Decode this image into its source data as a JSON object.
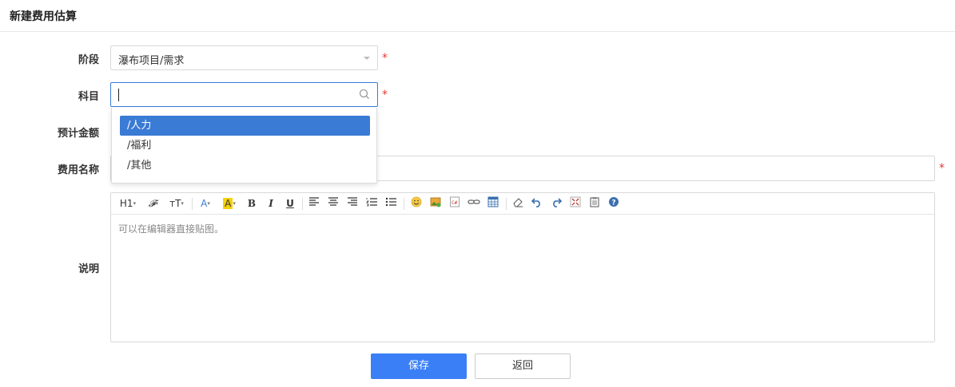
{
  "header": {
    "title": "新建费用估算"
  },
  "form": {
    "stage": {
      "label": "阶段",
      "value": "瀑布项目/需求",
      "required": "*"
    },
    "subject": {
      "label": "科目",
      "value": "",
      "required": "*",
      "options": [
        "/人力",
        "/福利",
        "/其他"
      ],
      "selected_index": 0
    },
    "amount": {
      "label": "预计金额"
    },
    "name": {
      "label": "费用名称",
      "value": "",
      "required": "*"
    },
    "desc": {
      "label": "说明",
      "placeholder": "可以在编辑器直接贴图。"
    }
  },
  "toolbar": {
    "heading": "H1",
    "font": "𝓕",
    "size": "тT",
    "font_color": "A",
    "bg_color": "A",
    "bold": "B",
    "italic": "I",
    "underline": "U"
  },
  "buttons": {
    "save": "保存",
    "back": "返回"
  },
  "colors": {
    "accent": "#3a7ff6",
    "required": "#e53935",
    "highlight": "#f5d20a"
  }
}
